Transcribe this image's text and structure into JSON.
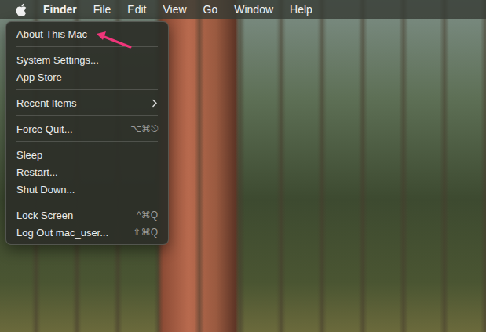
{
  "menubar": {
    "items": [
      {
        "label": "Finder",
        "bold": true
      },
      {
        "label": "File",
        "bold": false
      },
      {
        "label": "Edit",
        "bold": false
      },
      {
        "label": "View",
        "bold": false
      },
      {
        "label": "Go",
        "bold": false
      },
      {
        "label": "Window",
        "bold": false
      },
      {
        "label": "Help",
        "bold": false
      }
    ]
  },
  "apple_menu": {
    "groups": [
      [
        {
          "label": "About This Mac",
          "shortcut": "",
          "has_submenu": false
        }
      ],
      [
        {
          "label": "System Settings...",
          "shortcut": "",
          "has_submenu": false
        },
        {
          "label": "App Store",
          "shortcut": "",
          "has_submenu": false
        }
      ],
      [
        {
          "label": "Recent Items",
          "shortcut": "",
          "has_submenu": true
        }
      ],
      [
        {
          "label": "Force Quit...",
          "shortcut": "⌥⌘⎋",
          "has_submenu": false
        }
      ],
      [
        {
          "label": "Sleep",
          "shortcut": "",
          "has_submenu": false
        },
        {
          "label": "Restart...",
          "shortcut": "",
          "has_submenu": false
        },
        {
          "label": "Shut Down...",
          "shortcut": "",
          "has_submenu": false
        }
      ],
      [
        {
          "label": "Lock Screen",
          "shortcut": "^⌘Q",
          "has_submenu": false
        },
        {
          "label": "Log Out mac_user...",
          "shortcut": "⇧⌘Q",
          "has_submenu": false
        }
      ]
    ]
  }
}
